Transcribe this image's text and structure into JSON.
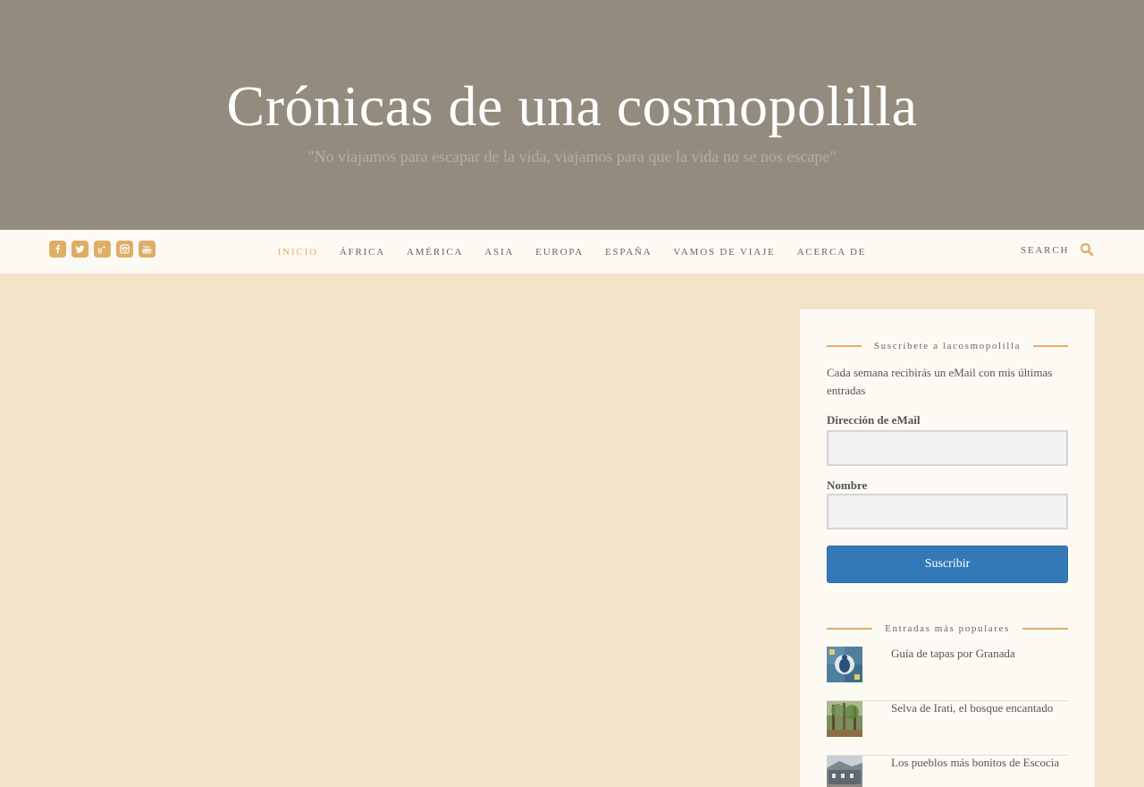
{
  "header": {
    "title": "Crónicas de una cosmopolilla",
    "tagline": "\"No viajamos para escapar de la vida, viajamos para que la vida no se nos escape\""
  },
  "social": [
    {
      "icon": "facebook-icon"
    },
    {
      "icon": "twitter-icon"
    },
    {
      "icon": "google-plus-icon"
    },
    {
      "icon": "instagram-icon"
    },
    {
      "icon": "youtube-icon"
    }
  ],
  "nav": {
    "items": [
      {
        "label": "INICIO",
        "active": true
      },
      {
        "label": "ÁFRICA"
      },
      {
        "label": "AMÉRICA"
      },
      {
        "label": "ASIA"
      },
      {
        "label": "EUROPA"
      },
      {
        "label": "ESPAÑA"
      },
      {
        "label": "VAMOS DE VIAJE"
      },
      {
        "label": "ACERCA DE"
      }
    ],
    "search_label": "SEARCH"
  },
  "subscribe": {
    "title": "Suscríbete a lacosmopolilla",
    "description": "Cada semana recibirás un eMail con mis últimas entradas",
    "email_label": "Dirección de eMail",
    "email_value": "",
    "name_label": "Nombre",
    "name_value": "",
    "button_label": "Suscribir"
  },
  "popular": {
    "title": "Entradas más populares",
    "items": [
      {
        "title": "Guía de tapas por Granada"
      },
      {
        "title": "Selva de Irati, el bosque encantado"
      },
      {
        "title": "Los pueblos más bonitos de Escocia"
      }
    ]
  },
  "colors": {
    "accent": "#e0ad66",
    "header_bg": "#938b7d",
    "page_bg": "#f3e3c9",
    "button": "#3479b7"
  }
}
